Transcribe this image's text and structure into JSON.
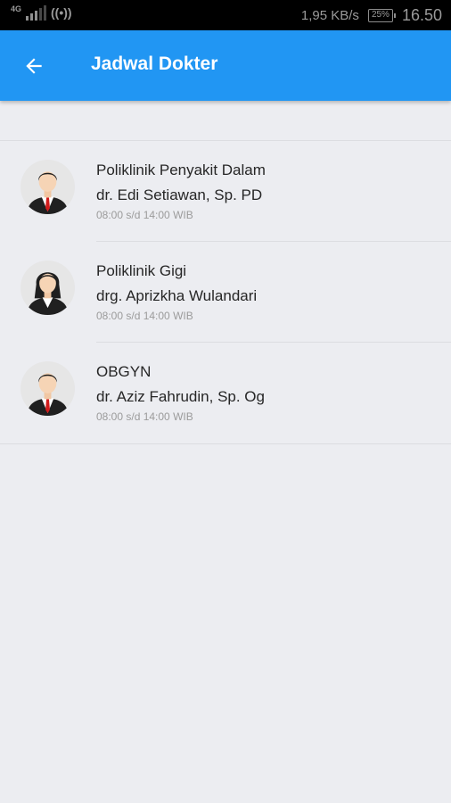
{
  "status_bar": {
    "network": "4G",
    "speed": "1,95 KB/s",
    "battery": "25%",
    "time": "16.50",
    "icons": [
      "signal-icon",
      "hotspot-icon",
      "battery-icon"
    ]
  },
  "app_bar": {
    "title": "Jadwal Dokter",
    "back_icon": "arrow-left-icon",
    "color": "#2196f3"
  },
  "doctors": [
    {
      "clinic": "Poliklinik Penyakit Dalam",
      "name": "dr. Edi Setiawan, Sp. PD",
      "hours": "08:00 s/d 14:00 WIB",
      "avatar": "male-doctor-avatar-icon"
    },
    {
      "clinic": "Poliklinik Gigi",
      "name": "drg. Aprizkha Wulandari",
      "hours": "08:00 s/d 14:00 WIB",
      "avatar": "female-doctor-avatar-icon"
    },
    {
      "clinic": "OBGYN",
      "name": "dr. Aziz Fahrudin, Sp. Og",
      "hours": "08:00 s/d 14:00 WIB",
      "avatar": "male-doctor-avatar-icon"
    }
  ]
}
